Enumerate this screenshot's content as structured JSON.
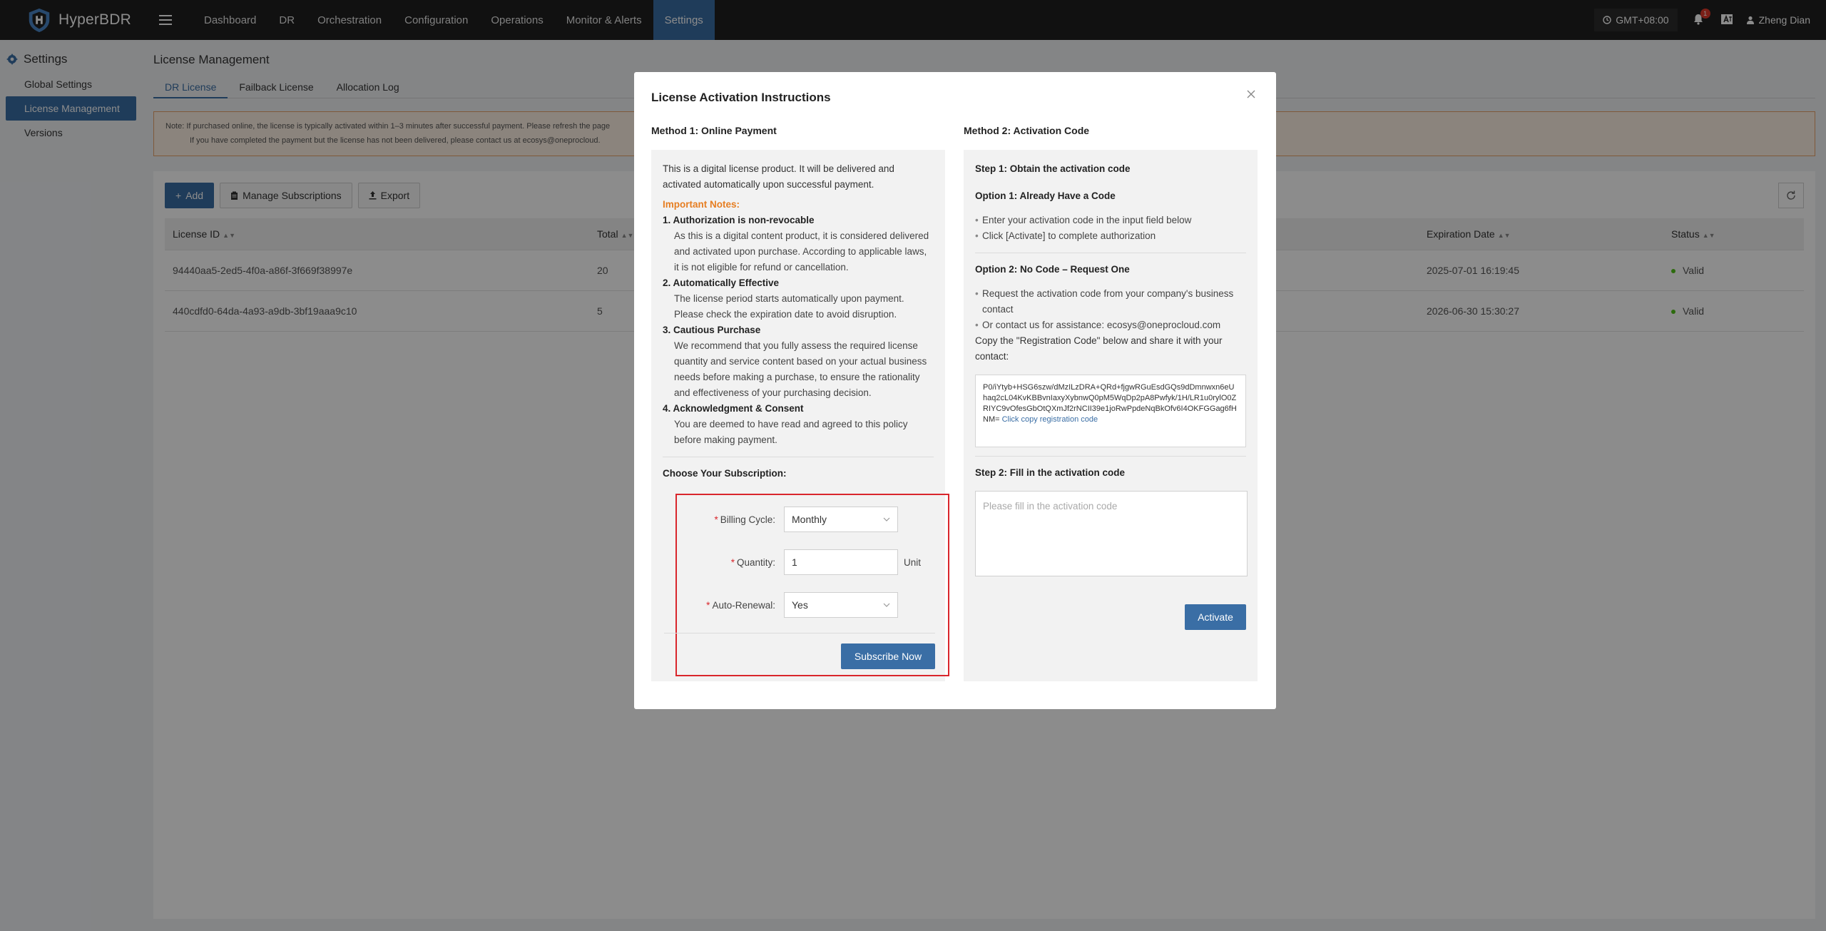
{
  "app": {
    "name": "HyperBDR"
  },
  "nav": {
    "items": [
      {
        "label": "Dashboard"
      },
      {
        "label": "DR"
      },
      {
        "label": "Orchestration"
      },
      {
        "label": "Configuration"
      },
      {
        "label": "Operations"
      },
      {
        "label": "Monitor & Alerts"
      },
      {
        "label": "Settings",
        "active": true
      }
    ]
  },
  "header": {
    "timezone": "GMT+08:00",
    "notification_count": "1",
    "user_name": "Zheng Dian"
  },
  "sidebar": {
    "title": "Settings",
    "items": [
      {
        "label": "Global Settings"
      },
      {
        "label": "License Management",
        "active": true
      },
      {
        "label": "Versions"
      }
    ]
  },
  "page": {
    "title": "License Management",
    "tabs": [
      {
        "label": "DR License",
        "active": true
      },
      {
        "label": "Failback License"
      },
      {
        "label": "Allocation Log"
      }
    ],
    "note_line1": "Note: If purchased online, the license is typically activated within 1–3 minutes after successful payment. Please refresh the page",
    "note_line2": "If you have completed the payment but the license has not been delivered, please contact us at ecosys@oneprocloud.",
    "toolbar": {
      "add_label": "Add",
      "manage_label": "Manage Subscriptions",
      "export_label": "Export"
    },
    "table": {
      "headers": {
        "license_id": "License ID",
        "total": "Total",
        "expiration": "Expiration Date",
        "status": "Status"
      },
      "rows": [
        {
          "license_id": "94440aa5-2ed5-4f0a-a86f-3f669f38997e",
          "total": "20",
          "expiration": "2025-07-01 16:19:45",
          "status": "Valid"
        },
        {
          "license_id": "440cdfd0-64da-4a93-a9db-3bf19aaa9c10",
          "total": "5",
          "expiration": "2026-06-30 15:30:27",
          "status": "Valid"
        }
      ]
    }
  },
  "modal": {
    "title": "License Activation Instructions",
    "method1": {
      "heading": "Method 1: Online Payment",
      "intro": "This is a digital license product. It will be delivered and activated automatically upon successful payment.",
      "important_label": "Important Notes:",
      "notes": [
        {
          "title": "1. Authorization is non-revocable",
          "body": "As this is a digital content product, it is considered delivered and activated upon purchase. According to applicable laws, it is not eligible for refund or cancellation."
        },
        {
          "title": "2. Automatically Effective",
          "body": "The license period starts automatically upon payment. Please check the expiration date to avoid disruption."
        },
        {
          "title": "3. Cautious Purchase",
          "body": "We recommend that you fully assess the required license quantity and service content based on your actual business needs before making a purchase, to ensure the rationality and effectiveness of your purchasing decision."
        },
        {
          "title": "4. Acknowledgment & Consent",
          "body": "You are deemed to have read and agreed to this policy before making payment."
        }
      ],
      "choose_label": "Choose Your Subscription:",
      "form": {
        "billing_label": "Billing Cycle:",
        "billing_value": "Monthly",
        "quantity_label": "Quantity:",
        "quantity_value": "1",
        "quantity_unit": "Unit",
        "renewal_label": "Auto-Renewal:",
        "renewal_value": "Yes",
        "subscribe_label": "Subscribe Now"
      }
    },
    "method2": {
      "heading": "Method 2: Activation Code",
      "step1": "Step 1: Obtain the activation code",
      "option1_title": "Option 1: Already Have a Code",
      "option1_bullets": [
        "Enter your activation code in the input field below",
        "Click [Activate] to complete authorization"
      ],
      "option2_title": "Option 2: No Code – Request One",
      "option2_bullets": [
        "Request the activation code from your company's business contact",
        "Or contact us for assistance: ecosys@oneprocloud.com"
      ],
      "copy_instruction": "Copy the \"Registration Code\" below and share it with your contact:",
      "registration_code": "P0/iYtyb+HSG6szw/dMzILzDRA+QRd+fjgwRGuEsdGQs9dDmnwxn6eUhaq2cL04KvKBBvnIaxyXybnwQ0pM5WqDp2pA8Pwfyk/1H/LR1u0rylO0ZRIYC9vOfesGbOtQXmJf2rNCII39e1joRwPpdeNqBkOfv6I4OKFGGag6fHNM=",
      "copy_link": "Click copy registration code",
      "step2": "Step 2: Fill in the activation code",
      "activation_placeholder": "Please fill in the activation code",
      "activate_label": "Activate"
    }
  }
}
